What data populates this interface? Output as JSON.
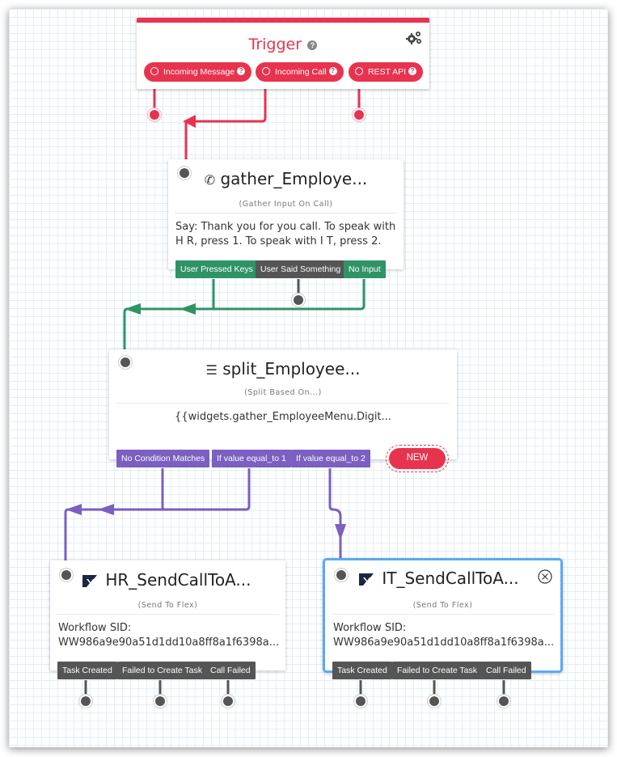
{
  "colors": {
    "trigger": "#e8334e",
    "gather_transitions": "#2e9466",
    "split_transitions": "#7b5fc1",
    "neutral_transition": "#555555",
    "selected_outline": "#5aaaf0"
  },
  "trigger": {
    "title": "Trigger",
    "help_icon": "question-circle-icon",
    "settings_icon": "gears-icon",
    "pills": [
      {
        "label": "Incoming Message"
      },
      {
        "label": "Incoming Call"
      },
      {
        "label": "REST API"
      }
    ]
  },
  "widgets": [
    {
      "id": "gather",
      "icon": "phone-icon",
      "title": "gather_Employe...",
      "subtitle": "(Gather Input On Call)",
      "body_lines": [
        "Say: Thank you for you call. To speak with",
        "H R, press 1. To speak with I T, press 2."
      ],
      "transitions": [
        "User Pressed Keys",
        "User Said Something",
        "No Input"
      ]
    },
    {
      "id": "split",
      "icon": "split-icon",
      "title": "split_Employee...",
      "subtitle": "(Split Based On...)",
      "body_lines": [
        "{{widgets.gather_EmployeeMenu.Digit..."
      ],
      "transitions": [
        "No Condition Matches",
        "If value equal_to 1",
        "If value equal_to 2"
      ],
      "new_button": "NEW"
    },
    {
      "id": "hr",
      "icon": "flex-logo-icon",
      "title": "HR_SendCallToA...",
      "subtitle": "(Send To Flex)",
      "body_lines": [
        "Workflow SID:",
        "WW986a9e90a51d1dd10a8ff8a1f6398a..."
      ],
      "transitions": [
        "Task Created",
        "Failed to Create Task",
        "Call Failed"
      ]
    },
    {
      "id": "it",
      "icon": "flex-logo-icon",
      "title": "IT_SendCallToA...",
      "subtitle": "(Send To Flex)",
      "body_lines": [
        "Workflow SID:",
        "WW986a9e90a51d1dd10a8ff8a1f6398a..."
      ],
      "transitions": [
        "Task Created",
        "Failed to Create Task",
        "Call Failed"
      ],
      "selected": true,
      "close_icon": "close-circle-icon"
    }
  ]
}
